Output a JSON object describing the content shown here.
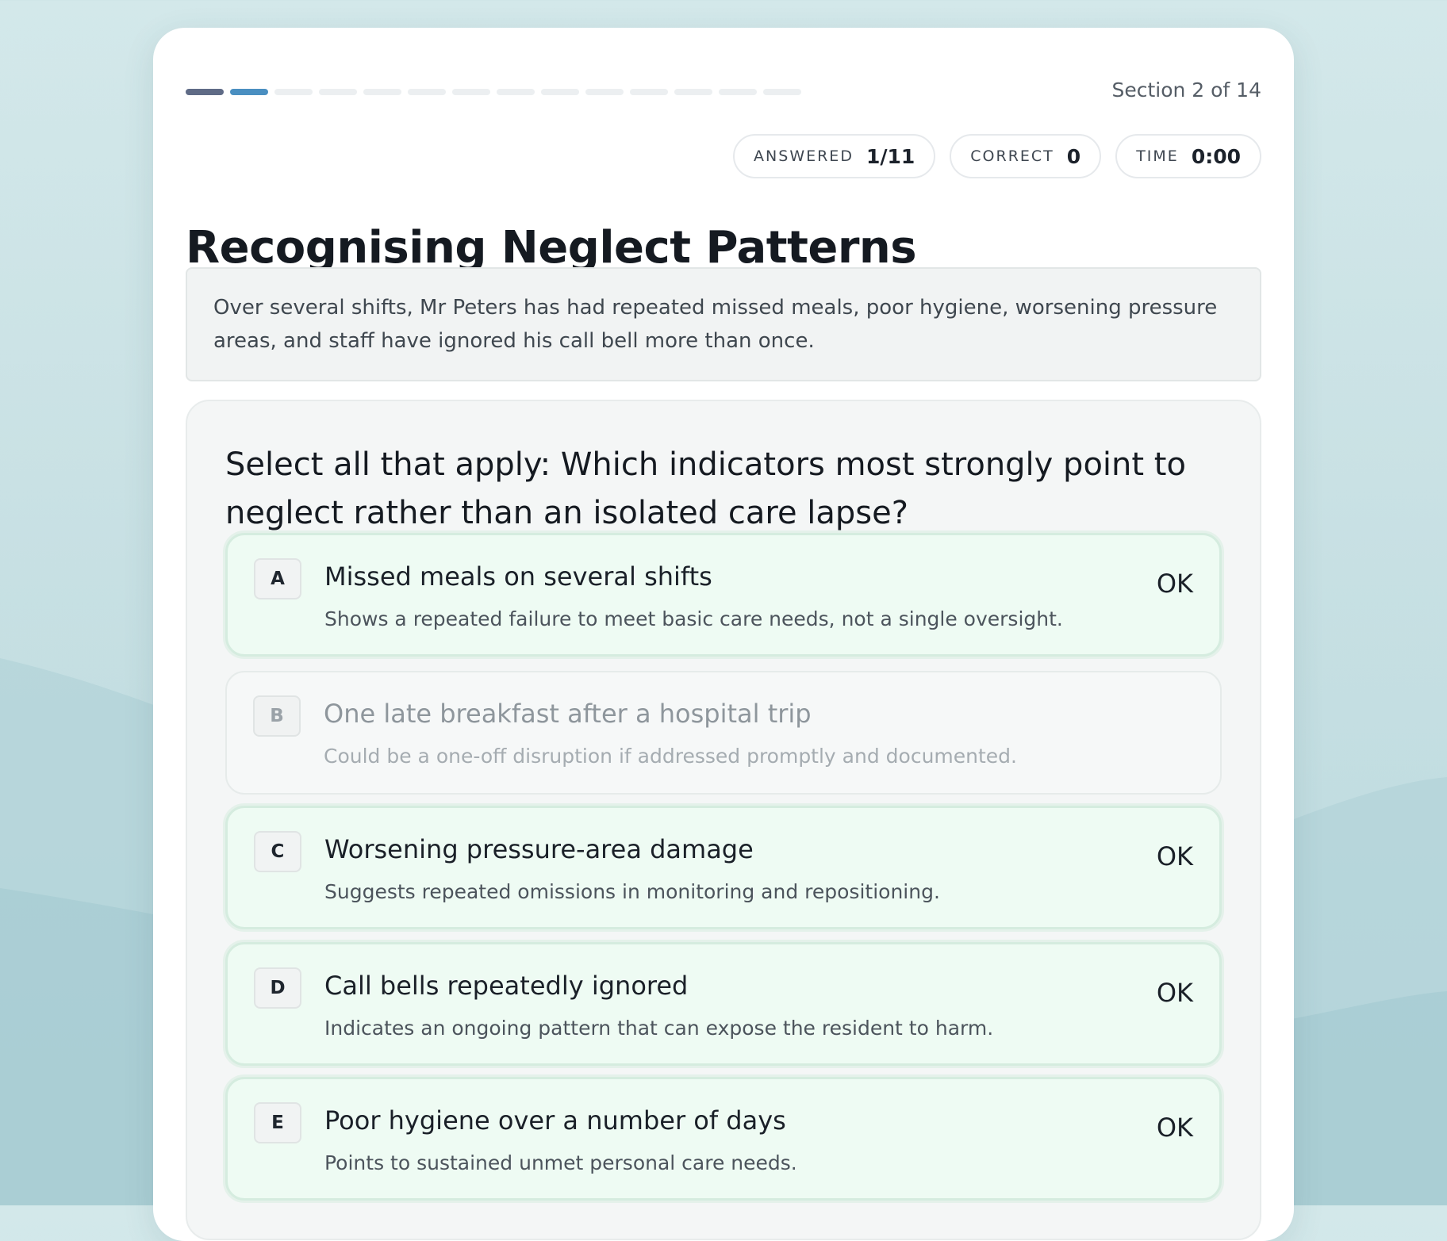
{
  "progress": {
    "section_label": "Section 2 of 14",
    "total_sections": 14,
    "completed_sections": 1,
    "current_section": 2
  },
  "stats": {
    "answered": {
      "label": "ANSWERED",
      "value": "1/11"
    },
    "correct": {
      "label": "CORRECT",
      "value": "0"
    },
    "time": {
      "label": "TIME",
      "value": "0:00"
    }
  },
  "title": "Recognising Neglect Patterns",
  "scenario": "Over several shifts, Mr Peters has had repeated missed meals, poor hygiene, worsening pressure areas, and staff have ignored his call bell more than once.",
  "question": "Select all that apply: Which indicators most strongly point to neglect rather than an isolated care lapse?",
  "options": [
    {
      "letter": "A",
      "title": "Missed meals on several shifts",
      "description": "Shows a repeated failure to meet basic care needs, not a single oversight.",
      "status": "OK"
    },
    {
      "letter": "B",
      "title": "One late breakfast after a hospital trip",
      "description": "Could be a one-off disruption if addressed promptly and documented.",
      "status": ""
    },
    {
      "letter": "C",
      "title": "Worsening pressure-area damage",
      "description": "Suggests repeated omissions in monitoring and repositioning.",
      "status": "OK"
    },
    {
      "letter": "D",
      "title": "Call bells repeatedly ignored",
      "description": "Indicates an ongoing pattern that can expose the resident to harm.",
      "status": "OK"
    },
    {
      "letter": "E",
      "title": "Poor hygiene over a number of days",
      "description": "Points to sustained unmet personal care needs.",
      "status": "OK"
    }
  ],
  "colors": {
    "segment_done": "#5f6b86",
    "segment_current": "#4a8fc1",
    "segment_pending": "#eceff1",
    "option_selected_bg": "#eefbf3"
  }
}
